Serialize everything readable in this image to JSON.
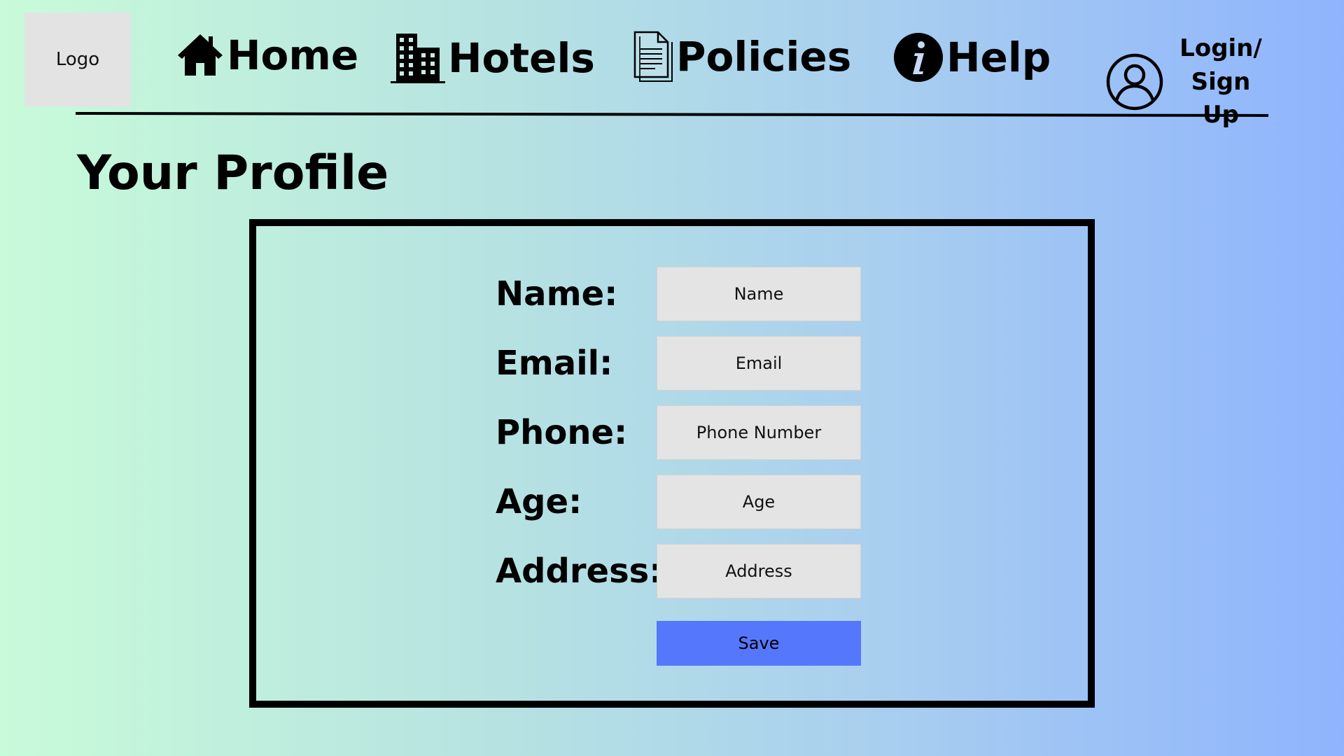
{
  "header": {
    "logo_label": "Logo",
    "nav": [
      {
        "label": "Home",
        "icon": "home-icon"
      },
      {
        "label": "Hotels",
        "icon": "building-icon"
      },
      {
        "label": "Policies",
        "icon": "document-icon"
      },
      {
        "label": "Help",
        "icon": "info-icon"
      }
    ],
    "login": {
      "line1": "Login/",
      "line2": "Sign Up",
      "icon": "user-icon"
    }
  },
  "page": {
    "title": "Your Profile"
  },
  "form": {
    "fields": [
      {
        "label": "Name:",
        "placeholder": "Name",
        "value": ""
      },
      {
        "label": "Email:",
        "placeholder": "Email",
        "value": ""
      },
      {
        "label": "Phone:",
        "placeholder": "Phone Number",
        "value": ""
      },
      {
        "label": "Age:",
        "placeholder": "Age",
        "value": ""
      },
      {
        "label": "Address:",
        "placeholder": "Address",
        "value": ""
      }
    ],
    "save_label": "Save"
  },
  "colors": {
    "gradient_start": "#c8fbd9",
    "gradient_end": "#8fb4fd",
    "input_background": "#e4e4e4",
    "save_button": "#5577fb",
    "logo_background": "#e3e3e3"
  }
}
